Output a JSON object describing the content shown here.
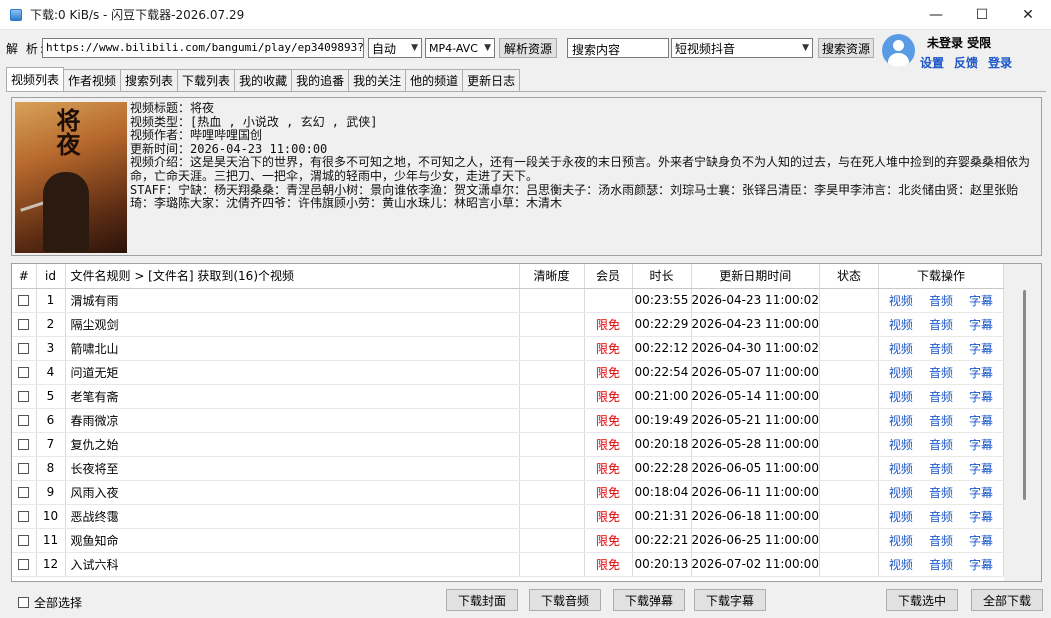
{
  "window": {
    "title": "下载:0 KiB/s - 闪豆下载器-2026.07.29",
    "controls": {
      "minimize": "—",
      "maximize": "☐",
      "close": "✕"
    }
  },
  "toolbar": {
    "parse_label": "解 析:",
    "url_value": "https://www.bilibili.com/bangumi/play/ep3409893?",
    "quality_select": "自动",
    "format_select": "MP4-AVC",
    "parse_button": "解析资源",
    "search_placeholder": "搜索内容",
    "search_source_select": "短视频抖音",
    "search_button": "搜索资源"
  },
  "user": {
    "status": "未登录  受限",
    "settings_link": "设置",
    "feedback_link": "反馈",
    "login_link": "登录"
  },
  "tabs": [
    "视频列表",
    "作者视频",
    "搜索列表",
    "下载列表",
    "我的收藏",
    "我的追番",
    "我的关注",
    "他的频道",
    "更新日志"
  ],
  "info": {
    "cover_title": "将夜",
    "title_line": "视频标题：将夜",
    "type_line": "视频类型：[热血 , 小说改 , 玄幻 , 武侠]",
    "author_line": "视频作者：哔哩哔哩国创",
    "updated_line": "更新时间：2026-04-23 11:00:00",
    "intro_line": "视频介绍：这是昊天治下的世界，有很多不可知之地，不可知之人，还有一段关于永夜的末日预言。外来者宁缺身负不为人知的过去，与在死人堆中捡到的弃婴桑桑相依为命，亡命天涯。三把刀、一把伞，渭城的轻雨中，少年与少女，走进了天下。",
    "staff_line": "STAFF：宁缺：杨天翔桑桑：青涅邑朝小树：景向谁依李渔：贺文潇卓尔：吕思衡夫子：汤水雨颜瑟：刘琮马士襄：张铎吕清臣：李昊甲李沛言：北炎储由贤：赵里张贻琦：李璐陈大家：沈倩齐四爷：许伟旗顾小劳：黄山水珠儿：林昭言小草：木清木"
  },
  "table": {
    "headers": {
      "index": "#",
      "id": "id",
      "name": "文件名规则  >  [文件名]     获取到(16)个视频",
      "clarity": "清晰度",
      "member": "会员",
      "duration": "时长",
      "updated": "更新日期时间",
      "status": "状态",
      "ops": "下载操作"
    },
    "op_labels": {
      "video": "视频",
      "audio": "音频",
      "subtitle": "字幕"
    },
    "rows": [
      {
        "id": "1",
        "name": "渭城有雨",
        "member": "",
        "duration": "00:23:55",
        "updated": "2026-04-23 11:00:02"
      },
      {
        "id": "2",
        "name": "隔尘观剑",
        "member": "限免",
        "duration": "00:22:29",
        "updated": "2026-04-23 11:00:00"
      },
      {
        "id": "3",
        "name": "箭啸北山",
        "member": "限免",
        "duration": "00:22:12",
        "updated": "2026-04-30 11:00:02"
      },
      {
        "id": "4",
        "name": "问道无矩",
        "member": "限免",
        "duration": "00:22:54",
        "updated": "2026-05-07 11:00:00"
      },
      {
        "id": "5",
        "name": "老笔有斋",
        "member": "限免",
        "duration": "00:21:00",
        "updated": "2026-05-14 11:00:00"
      },
      {
        "id": "6",
        "name": "春雨微凉",
        "member": "限免",
        "duration": "00:19:49",
        "updated": "2026-05-21 11:00:00"
      },
      {
        "id": "7",
        "name": "复仇之始",
        "member": "限免",
        "duration": "00:20:18",
        "updated": "2026-05-28 11:00:00"
      },
      {
        "id": "8",
        "name": "长夜将至",
        "member": "限免",
        "duration": "00:22:28",
        "updated": "2026-06-05 11:00:00"
      },
      {
        "id": "9",
        "name": "风雨入夜",
        "member": "限免",
        "duration": "00:18:04",
        "updated": "2026-06-11 11:00:00"
      },
      {
        "id": "10",
        "name": "恶战终霭",
        "member": "限免",
        "duration": "00:21:31",
        "updated": "2026-06-18 11:00:00"
      },
      {
        "id": "11",
        "name": "观鱼知命",
        "member": "限免",
        "duration": "00:22:21",
        "updated": "2026-06-25 11:00:00"
      },
      {
        "id": "12",
        "name": "入试六科",
        "member": "限免",
        "duration": "00:20:13",
        "updated": "2026-07-02 11:00:00"
      }
    ]
  },
  "footer": {
    "select_all": "全部选择",
    "download_cover": "下载封面",
    "download_audio": "下载音频",
    "download_danmaku": "下载弹幕",
    "download_subtitle": "下载字幕",
    "download_selected": "下载选中",
    "download_all": "全部下载"
  },
  "colors": {
    "link_blue": "#1a56c9",
    "free_red": "#e10000",
    "avatar_blue": "#5a9be6"
  }
}
